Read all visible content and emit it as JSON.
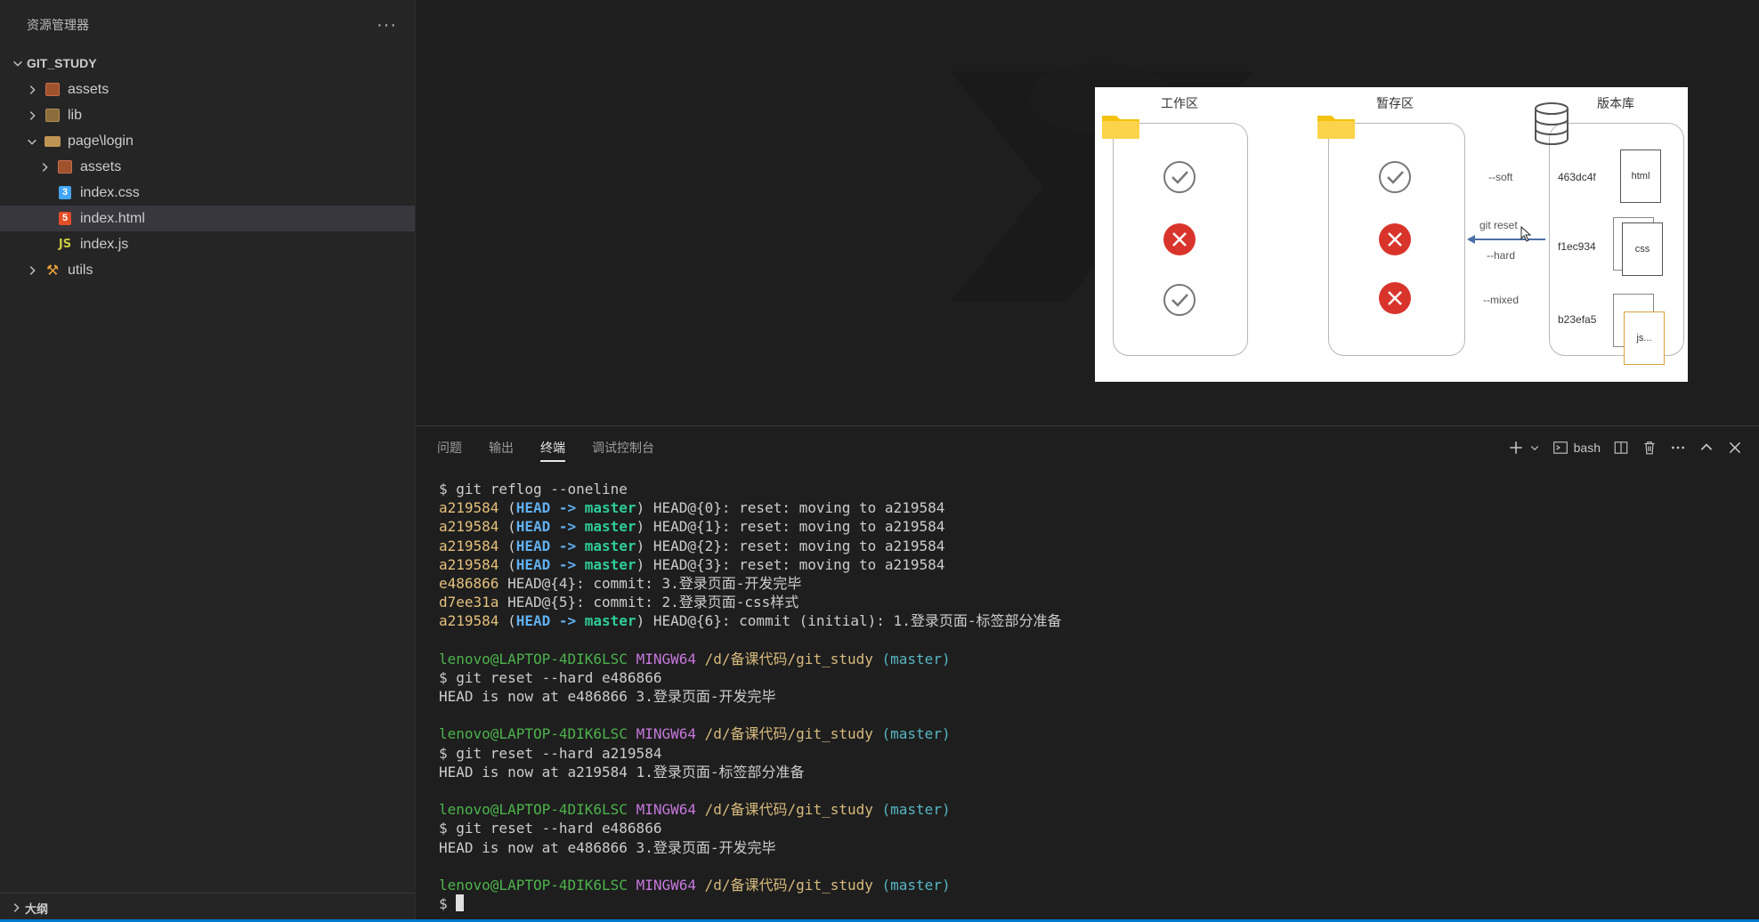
{
  "explorer": {
    "title": "资源管理器",
    "more": "···",
    "root": "GIT_STUDY",
    "items": [
      {
        "label": "assets",
        "expanded": false,
        "indent": 0,
        "icon": "assets-folder-icon"
      },
      {
        "label": "lib",
        "expanded": false,
        "indent": 0,
        "icon": "lib-folder-icon"
      },
      {
        "label": "page\\login",
        "expanded": true,
        "indent": 0,
        "icon": "folder-open-icon"
      },
      {
        "label": "assets",
        "expanded": false,
        "indent": 1,
        "icon": "assets-folder-icon"
      },
      {
        "label": "index.css",
        "indent": 1,
        "icon": "css-file-icon"
      },
      {
        "label": "index.html",
        "indent": 1,
        "icon": "html-file-icon",
        "selected": true
      },
      {
        "label": "index.js",
        "indent": 1,
        "icon": "js-file-icon"
      },
      {
        "label": "utils",
        "expanded": false,
        "indent": 0,
        "icon": "utils-folder-icon"
      }
    ],
    "outline_label": "大纲"
  },
  "diagram": {
    "zones": [
      "工作区",
      "暂存区",
      "版本库"
    ],
    "options": [
      "--soft",
      "git reset",
      "--hard",
      "--mixed"
    ],
    "commits": [
      "463dc4f",
      "f1ec934",
      "b23efa5"
    ],
    "files": [
      "html",
      "css",
      "js..."
    ]
  },
  "panel": {
    "tabs": [
      "问题",
      "输出",
      "终端",
      "调试控制台"
    ],
    "active_tab": "终端",
    "shell": "bash"
  },
  "terminal": {
    "reflog_cmd": "$ git reflog --oneline",
    "reflog": [
      {
        "hash": "a219584",
        "refs": true,
        "text": " HEAD@{0}: reset: moving to a219584"
      },
      {
        "hash": "a219584",
        "refs": true,
        "text": " HEAD@{1}: reset: moving to a219584"
      },
      {
        "hash": "a219584",
        "refs": true,
        "text": " HEAD@{2}: reset: moving to a219584"
      },
      {
        "hash": "a219584",
        "refs": true,
        "text": " HEAD@{3}: reset: moving to a219584"
      },
      {
        "hash": "e486866",
        "refs": false,
        "text": " HEAD@{4}: commit: 3.登录页面-开发完毕"
      },
      {
        "hash": "d7ee31a",
        "refs": false,
        "text": " HEAD@{5}: commit: 2.登录页面-css样式"
      },
      {
        "hash": "a219584",
        "refs": true,
        "text": " HEAD@{6}: commit (initial): 1.登录页面-标签部分准备"
      }
    ],
    "ref_head": "HEAD",
    "ref_arrow": " -> ",
    "ref_master": "master",
    "prompt": {
      "user": "lenovo@LAPTOP-4DIK6LSC",
      "mingw": "MINGW64",
      "path": "/d/备课代码/git_study",
      "branch": "(master)"
    },
    "blocks": [
      {
        "cmd": "$ git reset --hard e486866",
        "out": "HEAD is now at e486866 3.登录页面-开发完毕"
      },
      {
        "cmd": "$ git reset --hard a219584",
        "out": "HEAD is now at a219584 1.登录页面-标签部分准备"
      },
      {
        "cmd": "$ git reset --hard e486866",
        "out": "HEAD is now at e486866 3.登录页面-开发完毕"
      }
    ],
    "final_prompt": "$ "
  }
}
